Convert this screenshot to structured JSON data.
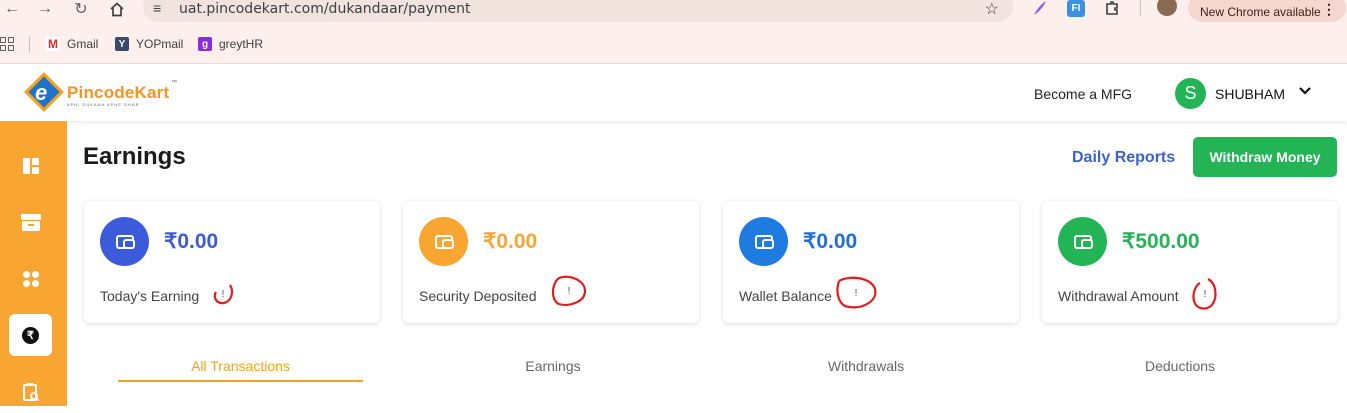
{
  "browser": {
    "url": "uat.pincodekart.com/dukandaar/payment",
    "new_chrome_label": "New Chrome available",
    "bookmarks": [
      {
        "label": "Gmail",
        "icon": "gmail-icon"
      },
      {
        "label": "YOPmail",
        "icon": "yopmail-icon"
      },
      {
        "label": "greytHR",
        "icon": "greythr-icon"
      }
    ]
  },
  "header": {
    "logo_text_pincode": "Pincode",
    "logo_text_kart": "Kart",
    "logo_tagline": "APNI DUKAAN APNE GHAR",
    "become_mfg": "Become a MFG",
    "avatar_letter": "S",
    "username": "SHUBHAM"
  },
  "sidebar": {
    "items": [
      "dashboard-icon",
      "store-icon",
      "grid-icon",
      "rupee-icon",
      "report-icon"
    ],
    "active_index": 3,
    "rupee_symbol": "₹"
  },
  "main": {
    "title": "Earnings",
    "daily_reports": "Daily Reports",
    "withdraw_button": "Withdraw Money",
    "info_mark": "!",
    "cards": [
      {
        "amount": "₹0.00",
        "label": "Today's Earning",
        "color": "#3b5bdb",
        "amount_color": "#3d5ad8"
      },
      {
        "amount": "₹0.00",
        "label": "Security Deposited",
        "color": "#f9a532",
        "amount_color": "#f9a532"
      },
      {
        "amount": "₹0.00",
        "label": "Wallet Balance",
        "color": "#1e7be0",
        "amount_color": "#1e6fd9"
      },
      {
        "amount": "₹500.00",
        "label": "Withdrawal Amount",
        "color": "#22b455",
        "amount_color": "#22b455"
      }
    ],
    "tabs": [
      {
        "label": "All Transactions",
        "active": true
      },
      {
        "label": "Earnings",
        "active": false
      },
      {
        "label": "Withdrawals",
        "active": false
      },
      {
        "label": "Deductions",
        "active": false
      }
    ]
  },
  "colors": {
    "accent_orange": "#f9a532",
    "success_green": "#22b455",
    "link_blue": "#3d63c8",
    "annotation_red": "#e21b1b"
  }
}
